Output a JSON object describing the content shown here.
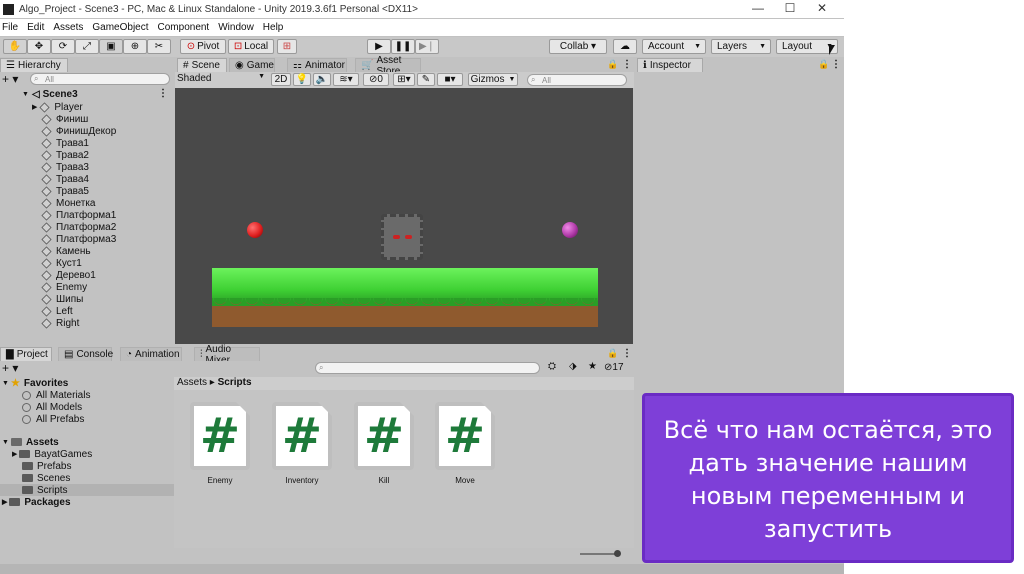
{
  "titlebar": {
    "title": "Algo_Project - Scene3 - PC, Mac & Linux Standalone - Unity 2019.3.6f1 Personal <DX11>",
    "minimize": "—",
    "maximize": "☐",
    "close": "✕"
  },
  "menu": [
    "File",
    "Edit",
    "Assets",
    "GameObject",
    "Component",
    "Window",
    "Help"
  ],
  "toolbar": {
    "pivot": "Pivot",
    "local": "Local",
    "collab": "Collab ▾",
    "account": "Account",
    "layers": "Layers",
    "layout": "Layout"
  },
  "hierarchy": {
    "tab": "Hierarchy",
    "search_placeholder": "All",
    "scene": "Scene3",
    "items": [
      "Player",
      "Финиш",
      "ФинишДекор",
      "Трава1",
      "Трава2",
      "Трава3",
      "Трава4",
      "Трава5",
      "Монетка",
      "Платформа1",
      "Платформа2",
      "Платформа3",
      "Камень",
      "Куст1",
      "Дерево1",
      "Enemy",
      "Шипы",
      "Left",
      "Right"
    ]
  },
  "scene_view": {
    "tabs": [
      "Scene",
      "Game",
      "Animator",
      "Asset Store"
    ],
    "shading": "Shaded",
    "mode_2d": "2D",
    "effects_count": "0",
    "gizmos": "Gizmos",
    "search_placeholder": "All"
  },
  "inspector": {
    "tab": "Inspector"
  },
  "project": {
    "tabs": [
      "Project",
      "Console",
      "Animation",
      "Audio Mixer"
    ],
    "hidden_count": "17",
    "breadcrumb_root": "Assets",
    "breadcrumb_current": "Scripts",
    "favorites": {
      "label": "Favorites",
      "items": [
        "All Materials",
        "All Models",
        "All Prefabs"
      ]
    },
    "assets": {
      "label": "Assets",
      "items": [
        "BayatGames",
        "Prefabs",
        "Scenes",
        "Scripts"
      ]
    },
    "packages": "Packages",
    "files": [
      {
        "name": "Enemy",
        "glyph": "#"
      },
      {
        "name": "Inventory",
        "glyph": "#"
      },
      {
        "name": "Kill",
        "glyph": "#"
      },
      {
        "name": "Move",
        "glyph": "#"
      }
    ]
  },
  "callout": {
    "lines": [
      "Всё что нам остаётся, это",
      "дать значение нашим",
      "новым переменным и",
      "запустить"
    ]
  },
  "colors": {
    "callout_bg": "#7e3fd8",
    "scene_bg": "#494949",
    "grass": "#3fd134",
    "dirt": "#8f5a2e",
    "red_ball": "#e02020",
    "purple_ball": "#b03aa8",
    "script_hash": "#1e7a3a"
  }
}
